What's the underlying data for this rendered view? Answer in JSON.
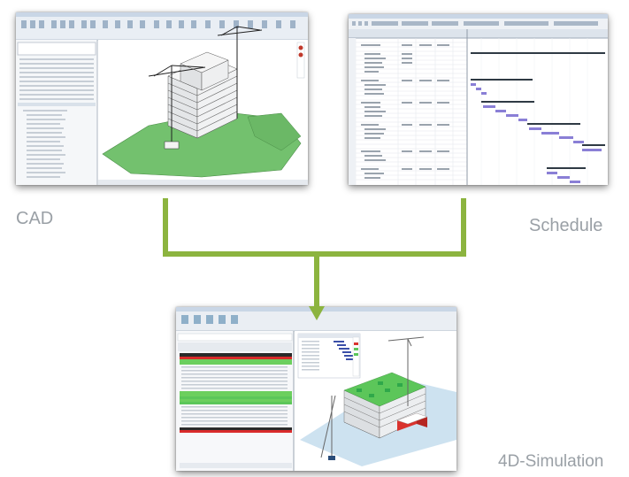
{
  "labels": {
    "cad": "CAD",
    "schedule": "Schedule",
    "simulation": "4D-Simulation"
  },
  "colors": {
    "arrow": "#8cb43f",
    "label": "#9aa0a6",
    "ground": "#6fc36b",
    "sky": "#cde2f0",
    "gantt_bar": "#8a7fd6",
    "summary_bar": "#2f3a44",
    "active_row": "#5cc65a",
    "red_row": "#d92b2b"
  },
  "icons": [
    "cad-screenshot",
    "schedule-screenshot",
    "simulation-screenshot",
    "arrow-down-icon"
  ]
}
